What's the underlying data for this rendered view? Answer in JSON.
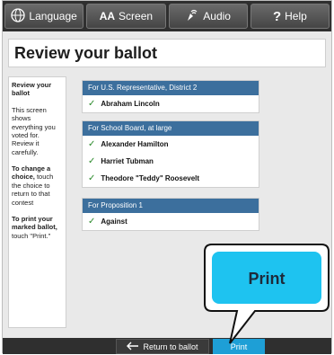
{
  "toolbar": {
    "language": {
      "label": "Language",
      "icon": "language-icon"
    },
    "screen": {
      "label": "Screen",
      "prefix": "AA",
      "icon": "text-size-icon"
    },
    "audio": {
      "label": "Audio",
      "icon": "audio-icon"
    },
    "help": {
      "label": "Help",
      "icon": "help-icon"
    }
  },
  "title": "Review your ballot",
  "help_panel": {
    "heading": "Review your ballot",
    "intro": "This screen shows everything you voted for. Review it carefully.",
    "change_bold": "To change a choice,",
    "change_rest": "touch the choice to return to that contest",
    "print_bold": "To print your marked ballot,",
    "print_rest": "touch \"Print.\""
  },
  "contests": [
    {
      "title": "For U.S. Representative, District 2",
      "choices": [
        "Abraham Lincoln"
      ]
    },
    {
      "title": "For School Board, at large",
      "choices": [
        "Alexander Hamilton",
        "Harriet Tubman",
        "Theodore \"Teddy\" Roosevelt"
      ]
    },
    {
      "title": "For Proposition 1",
      "choices": [
        "Against"
      ]
    }
  ],
  "bottom": {
    "return_label": "Return to ballot",
    "print_label": "Print"
  },
  "callout": {
    "label": "Print"
  },
  "colors": {
    "accent": "#1e9fd6",
    "contest_header": "#3c6f9d",
    "check": "#2b8a2b",
    "toolbar": "#2f2f2f"
  }
}
